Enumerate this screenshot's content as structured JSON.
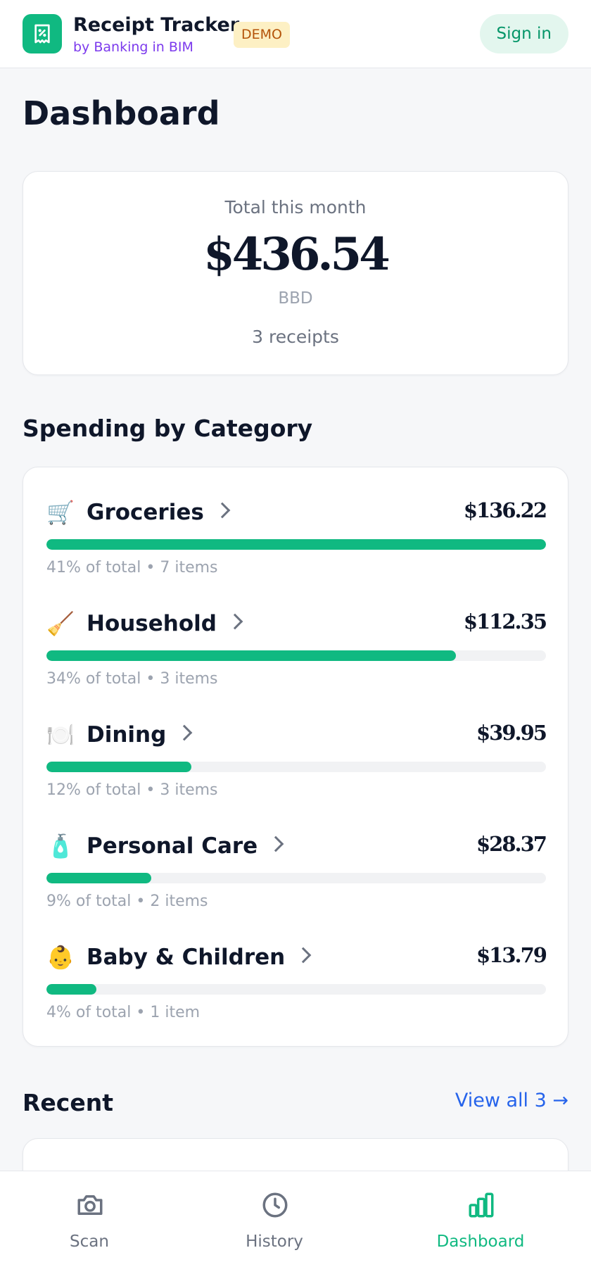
{
  "header": {
    "app_title": "Receipt Tracker",
    "app_subtitle": "by Banking in BIM",
    "badge": "DEMO",
    "signin_label": "Sign in"
  },
  "page": {
    "title": "Dashboard"
  },
  "summary": {
    "label": "Total this month",
    "amount": "$436.54",
    "currency": "BBD",
    "receipt_count": "3 receipts"
  },
  "spending": {
    "title": "Spending by Category",
    "categories": [
      {
        "icon": "shopping-cart-icon",
        "emoji": "🛒",
        "name": "Groceries",
        "amount": "$136.22",
        "bar_percent": 100,
        "meta": "41% of total • 7 items"
      },
      {
        "icon": "broom-icon",
        "emoji": "🧹",
        "name": "Household",
        "amount": "$112.35",
        "bar_percent": 82,
        "meta": "34% of total • 3 items"
      },
      {
        "icon": "plate-cutlery-icon",
        "emoji": "🍽️",
        "name": "Dining",
        "amount": "$39.95",
        "bar_percent": 29,
        "meta": "12% of total • 3 items"
      },
      {
        "icon": "lotion-bottle-icon",
        "emoji": "🧴",
        "name": "Personal Care",
        "amount": "$28.37",
        "bar_percent": 21,
        "meta": "9% of total • 2 items"
      },
      {
        "icon": "baby-icon",
        "emoji": "👶",
        "name": "Baby & Children",
        "amount": "$13.79",
        "bar_percent": 10,
        "meta": "4% of total • 1 item"
      }
    ]
  },
  "recent": {
    "title": "Recent",
    "view_all_label": "View all 3 →"
  },
  "nav": {
    "items": [
      {
        "label": "Scan",
        "icon": "camera-icon",
        "active": false
      },
      {
        "label": "History",
        "icon": "clock-icon",
        "active": false
      },
      {
        "label": "Dashboard",
        "icon": "bar-chart-icon",
        "active": true
      }
    ]
  },
  "colors": {
    "accent": "#10b981",
    "subtitle_purple": "#7c3aed",
    "link_blue": "#2563eb",
    "badge_bg": "#fdf0c4",
    "badge_text": "#b45309"
  }
}
